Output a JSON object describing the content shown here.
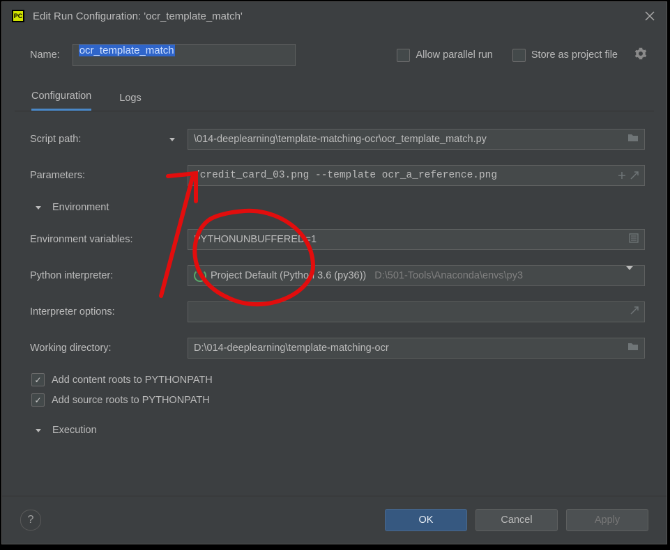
{
  "window": {
    "title": "Edit Run Configuration: 'ocr_template_match'"
  },
  "header": {
    "name_label": "Name:",
    "name_value": "ocr_template_match",
    "allow_parallel_label": "Allow parallel run",
    "store_as_project_file_label": "Store as project file"
  },
  "tabs": {
    "configuration_label": "Configuration",
    "logs_label": "Logs"
  },
  "config": {
    "script_path_label": "Script path:",
    "script_path_value": "\\014-deeplearning\\template-matching-ocr\\ocr_template_match.py",
    "parameters_label": "Parameters:",
    "parameters_value": "/credit_card_03.png --template ocr_a_reference.png",
    "environment_header": "Environment",
    "env_vars_label": "Environment variables:",
    "env_vars_value": "PYTHONUNBUFFERED=1",
    "python_interp_label": "Python interpreter:",
    "python_interp_value": "Project Default (Python 3.6 (py36))",
    "python_interp_path": "D:\\501-Tools\\Anaconda\\envs\\py3",
    "interp_options_label": "Interpreter options:",
    "interp_options_value": "",
    "working_dir_label": "Working directory:",
    "working_dir_value": "D:\\014-deeplearning\\template-matching-ocr",
    "add_content_roots_label": "Add content roots to PYTHONPATH",
    "add_source_roots_label": "Add source roots to PYTHONPATH",
    "execution_header": "Execution"
  },
  "footer": {
    "ok_label": "OK",
    "cancel_label": "Cancel",
    "apply_label": "Apply"
  }
}
